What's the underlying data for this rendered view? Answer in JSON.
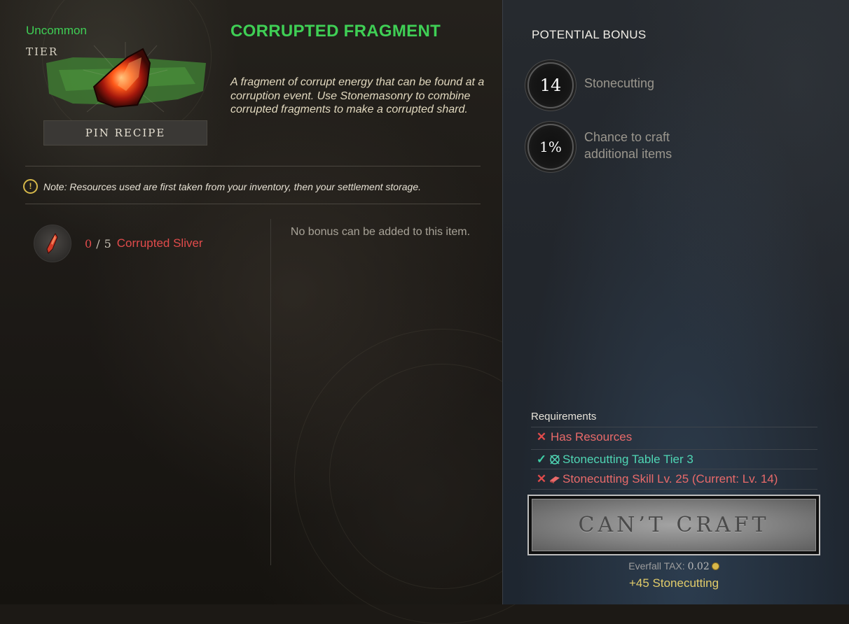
{
  "item": {
    "rarity": "Uncommon",
    "tier_label": "TIER",
    "title": "CORRUPTED FRAGMENT",
    "description": "A fragment of corrupt energy that can be found at a corruption event. Use Stonemasonry to combine corrupted fragments to make a corrupted shard.",
    "pin_button": "PIN RECIPE",
    "rarity_color": "#3fcf55"
  },
  "note": {
    "icon": "exclamation-icon",
    "text": "Note: Resources used are first taken from your inventory, then your settlement storage."
  },
  "resources": [
    {
      "icon": "corrupted-sliver-icon",
      "have": "0",
      "separator": "/",
      "need": "5",
      "name": "Corrupted Sliver"
    }
  ],
  "bonus_area": {
    "text": "No bonus can be added to this item."
  },
  "potential_bonus": {
    "title": "POTENTIAL BONUS",
    "items": [
      {
        "value": "14",
        "label": "Stonecutting"
      },
      {
        "value": "1%",
        "label": "Chance to craft additional items"
      }
    ]
  },
  "requirements": {
    "title": "Requirements",
    "items": [
      {
        "status": "fail",
        "icon": "",
        "text": "Has Resources"
      },
      {
        "status": "ok",
        "icon": "crafting-station-icon",
        "text": "Stonecutting Table Tier 3"
      },
      {
        "status": "fail",
        "icon": "skill-icon",
        "text": "Stonecutting Skill Lv. 25 (Current: Lv. 14)"
      }
    ]
  },
  "craft": {
    "button_label": "CAN’T CRAFT",
    "tax_label": "Everfall TAX:",
    "tax_value": "0.02",
    "bonus": "+45 Stonecutting"
  },
  "colors": {
    "fail": "#e04b4b",
    "ok": "#3fd0a8",
    "gold": "#e2cc6a"
  }
}
